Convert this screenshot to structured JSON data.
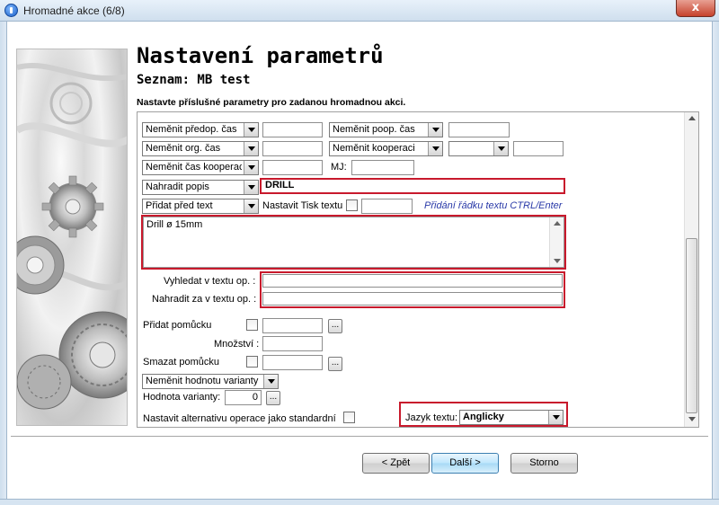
{
  "window": {
    "title": "Hromadné akce (6/8)",
    "close_label": "x"
  },
  "header": {
    "title": "Nastavení parametrů",
    "subtitle": "Seznam: MB test",
    "instruction": "Nastavte příslušné parametry pro zadanou hromadnou akci."
  },
  "form": {
    "row1": {
      "combo_left": "Neměnit předop. čas",
      "field_left": "",
      "combo_right": "Neměnit poop. čas",
      "field_right": ""
    },
    "row2": {
      "combo_left": "Neměnit org. čas",
      "field_left": "",
      "combo_right": "Neměnit kooperaci",
      "combo_small": "",
      "field_right": ""
    },
    "row3": {
      "combo_left": "Neměnit čas kooperace",
      "field_left": "",
      "mj_label": "MJ:",
      "mj_value": ""
    },
    "row4": {
      "combo": "Nahradit popis",
      "value": "DRILL"
    },
    "row5": {
      "combo": "Přidat před text",
      "tisk_label": "Nastavit Tisk textu",
      "tisk_value": "",
      "hint": "Přidání řádku textu CTRL/Enter"
    },
    "text_area": "Drill ø 15mm",
    "search_label": "Vyhledat v textu op.  :",
    "search_value": "",
    "replace_label": "Nahradit za v textu op.  :",
    "replace_value": "",
    "add_tool_label": "Přidat pomůcku",
    "add_tool_value": "",
    "quantity_label": "Množství :",
    "quantity_value": "",
    "remove_tool_label": "Smazat pomůcku",
    "remove_tool_value": "",
    "variant_combo": "Neměnit hodnotu varianty",
    "variant_value_label": "Hodnota varianty:",
    "variant_value": "0",
    "alt_operation_label": "Nastavit alternativu operace jako standardní",
    "language_label": "Jazyk textu:",
    "language_value": "Anglicky",
    "dots": "..."
  },
  "footer": {
    "back": "< Zpět",
    "next": "Další >",
    "cancel": "Storno"
  }
}
